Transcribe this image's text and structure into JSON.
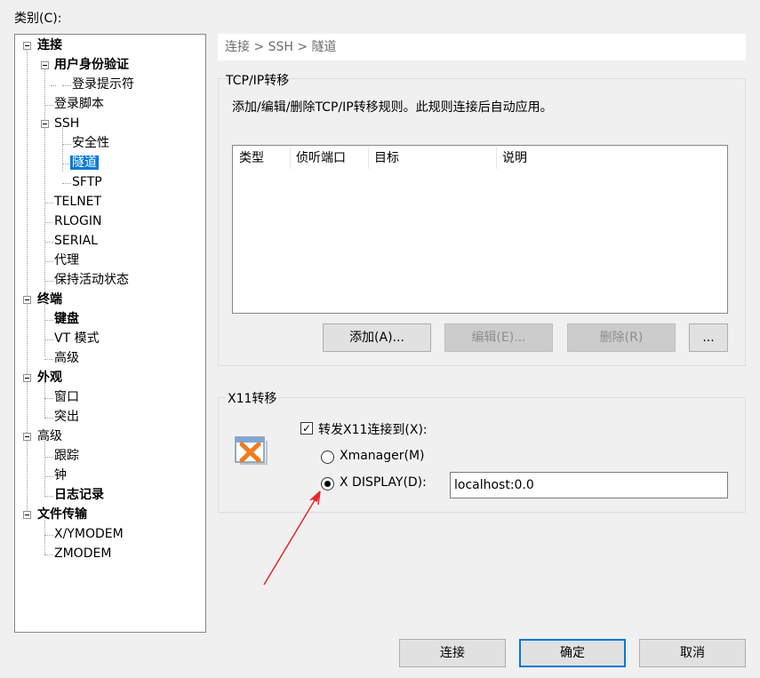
{
  "category_label": "类别(C):",
  "tree": {
    "items": [
      {
        "label": "连接",
        "bold": true
      },
      {
        "label": "用户身份验证",
        "bold": true
      },
      {
        "label": "登录提示符",
        "bold": false
      },
      {
        "label": "登录脚本",
        "bold": false
      },
      {
        "label": "SSH",
        "bold": false
      },
      {
        "label": "安全性",
        "bold": false
      },
      {
        "label": "隧道",
        "bold": false,
        "selected": true
      },
      {
        "label": "SFTP",
        "bold": false
      },
      {
        "label": "TELNET",
        "bold": false
      },
      {
        "label": "RLOGIN",
        "bold": false
      },
      {
        "label": "SERIAL",
        "bold": false
      },
      {
        "label": "代理",
        "bold": false
      },
      {
        "label": "保持活动状态",
        "bold": false
      },
      {
        "label": "终端",
        "bold": true
      },
      {
        "label": "键盘",
        "bold": true
      },
      {
        "label": "VT 模式",
        "bold": false
      },
      {
        "label": "高级",
        "bold": false
      },
      {
        "label": "外观",
        "bold": true
      },
      {
        "label": "窗口",
        "bold": false
      },
      {
        "label": "突出",
        "bold": false
      },
      {
        "label": "高级",
        "bold": false
      },
      {
        "label": "跟踪",
        "bold": false
      },
      {
        "label": "钟",
        "bold": false
      },
      {
        "label": "日志记录",
        "bold": true
      },
      {
        "label": "文件传输",
        "bold": true
      },
      {
        "label": "X/YMODEM",
        "bold": false
      },
      {
        "label": "ZMODEM",
        "bold": false
      }
    ]
  },
  "breadcrumb": "连接 > SSH > 隧道",
  "tcpip": {
    "title": "TCP/IP转移",
    "description": "添加/编辑/删除TCP/IP转移规则。此规则连接后自动应用。",
    "columns": [
      "类型",
      "侦听端口",
      "目标",
      "说明"
    ],
    "buttons": {
      "add": "添加(A)...",
      "edit": "编辑(E)...",
      "delete": "删除(R)",
      "more": "..."
    }
  },
  "x11": {
    "title": "X11转移",
    "forward_label": "转发X11连接到(X):",
    "forward_checked": true,
    "xmanager_label": "Xmanager(M)",
    "xdisplay_label": "X DISPLAY(D):",
    "selected_option": "X DISPLAY",
    "display_value": "localhost:0.0"
  },
  "footer": {
    "connect": "连接",
    "ok": "确定",
    "cancel": "取消"
  },
  "colors": {
    "selection": "#0078d7",
    "annotation_arrow": "#e8262b"
  }
}
